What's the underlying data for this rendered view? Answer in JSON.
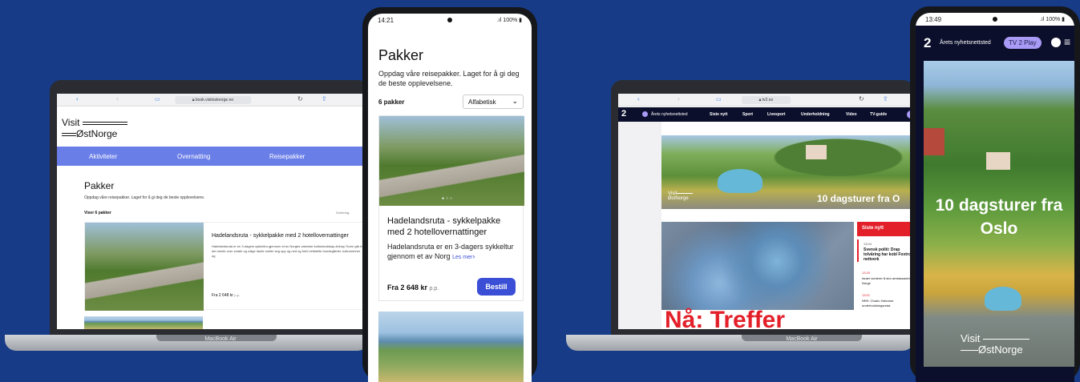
{
  "left_laptop": {
    "browser": {
      "url": "book.visitostnorge.no",
      "text_size": "AA"
    },
    "logo": {
      "visit": "Visit",
      "region": "ØstNorge"
    },
    "nav": [
      "Aktiviteter",
      "Overnatting",
      "Reisepakker"
    ],
    "page_title": "Pakker",
    "page_subtitle": "Oppdag våre reisepakker. Laget for å gi deg de beste opplevelsene.",
    "count_label": "Viser 6 pakker",
    "sort_label": "Sortering:",
    "card": {
      "title": "Hadelandsruta - sykkelpakke med 2 hotellovernattinger",
      "description": "Hadelandsruta er en 3-dagers sykkeltur gjennom et av Norges vakreste kulturlandskap.&nbsp;Turen går for det meste over smale og rolige lande smiler seg opp og ned og forbi veltstelte bondegårder, kulturminner og",
      "price": "Fra 2 648 kr",
      "price_unit": "p.p."
    },
    "model": "MacBook Air"
  },
  "left_phone": {
    "status": {
      "time": "14:21",
      "battery": "100%"
    },
    "title": "Pakker",
    "subtitle": "Oppdag våre reisepakker. Laget for å gi deg de beste opplevelsene.",
    "count": "6 pakker",
    "sort_value": "Alfabetisk",
    "card": {
      "title": "Hadelandsruta - sykkelpakke med 2 hotellovernattinger",
      "description": "Hadelandsruta er en 3-dagers sykkeltur gjennom et av Norg",
      "read_more": "Les mer",
      "price": "Fra 2 648 kr",
      "price_unit": "p.p.",
      "book_button": "Bestill"
    }
  },
  "right_laptop": {
    "browser": {
      "url": "tv2.no",
      "text_size": "AA"
    },
    "nav": {
      "brand_tagline": "Årets nyhetsnettsted",
      "items": [
        "Siste nytt",
        "Sport",
        "Livesport",
        "Underholdning",
        "Video",
        "TV-guide"
      ]
    },
    "ad": {
      "headline": "10 dagsturer fra O",
      "visit": "Visit",
      "region": "ØstNorge"
    },
    "latest": {
      "header": "Siste nytt",
      "items": [
        {
          "time": "13:04",
          "text": "Svensk politi: Drap tolvåring har kobl Foxtrot-nettverk"
        },
        {
          "time": "13:20",
          "text": "Israel vurderer å stor ambassaden i Norge"
        },
        {
          "time": "13:01",
          "text": "NRK: Charlo Halvorse underholdningsreda"
        }
      ]
    },
    "headline_fragment": "Nå: Treffer",
    "model": "MacBook Air"
  },
  "right_phone": {
    "status": {
      "time": "13:49",
      "battery": "100%"
    },
    "brand_tagline": "Årets nyhetsnettsted",
    "play_button": "TV 2 Play",
    "ad": {
      "headline": "10 dagsturer fra Oslo",
      "visit": "Visit",
      "region": "ØstNorge"
    }
  },
  "colors": {
    "background": "#173b87",
    "visit_nav": "#6a7ee8",
    "book_button": "#3b4fd6",
    "tv2_red": "#e3202a",
    "play_pill": "#a89af5"
  }
}
